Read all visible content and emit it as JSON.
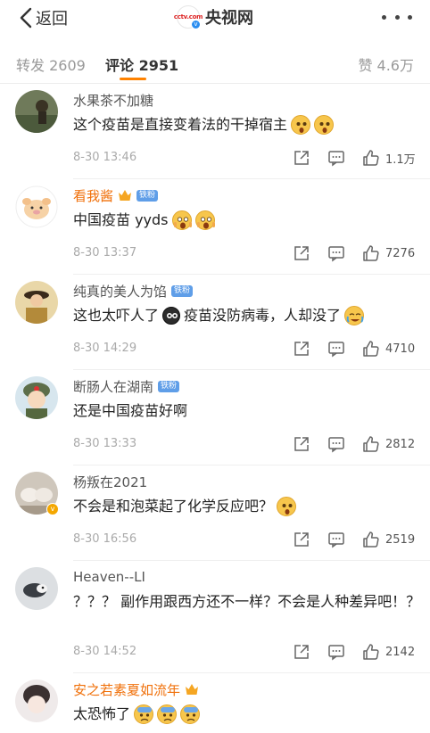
{
  "header": {
    "back_label": "返回",
    "title": "央视网",
    "logo_text": "cctv.com",
    "logo_badge": "v"
  },
  "tabs": {
    "repost": "转发 2609",
    "comment": "评论 2951",
    "like": "赞 4.6万"
  },
  "comments": [
    {
      "username": "水果茶不加糖",
      "vip": false,
      "badge": "",
      "text": "这个疫苗是直接变着法的干掉宿主",
      "emojis": [
        "surprise",
        "surprise"
      ],
      "time": "8-30 13:46",
      "likes": "1.1万"
    },
    {
      "username": "看我酱",
      "vip": true,
      "badge": "铁粉",
      "text": "中国疫苗 yyds",
      "emojis": [
        "scream",
        "scream"
      ],
      "time": "8-30 13:37",
      "likes": "7276"
    },
    {
      "username": "纯真的美人为馅",
      "vip": false,
      "badge": "铁粉",
      "text_a": "这也太吓人了",
      "text_b": "疫苗没防病毒，人却没了",
      "time": "8-30 14:29",
      "likes": "4710"
    },
    {
      "username": "断肠人在湖南",
      "vip": false,
      "badge": "铁粉",
      "text": "还是中国疫苗好啊",
      "emojis": [],
      "time": "8-30 13:33",
      "likes": "2812"
    },
    {
      "username": "杨叛在2021",
      "vip": false,
      "badge": "",
      "text": "不会是和泡菜起了化学反应吧？",
      "emojis": [
        "surprise"
      ],
      "time": "8-30 16:56",
      "likes": "2519",
      "avatar_v": "v"
    },
    {
      "username": "Heaven--LI",
      "vip": false,
      "badge": "",
      "text": "？？？ 副作用跟西方还不一样？不会是人种差异吧！？",
      "emojis": [],
      "time": "8-30 14:52",
      "likes": "2142"
    },
    {
      "username": "安之若素夏如流年",
      "vip": true,
      "badge": "",
      "text": "太恐怖了",
      "emojis": [
        "fear",
        "fear",
        "fear"
      ],
      "time": "",
      "likes": ""
    }
  ],
  "colors": {
    "accent": "#ff8200",
    "vip_name": "#f0700a",
    "iron_badge": "#5f9ee8",
    "meta": "#aaaaaa"
  }
}
